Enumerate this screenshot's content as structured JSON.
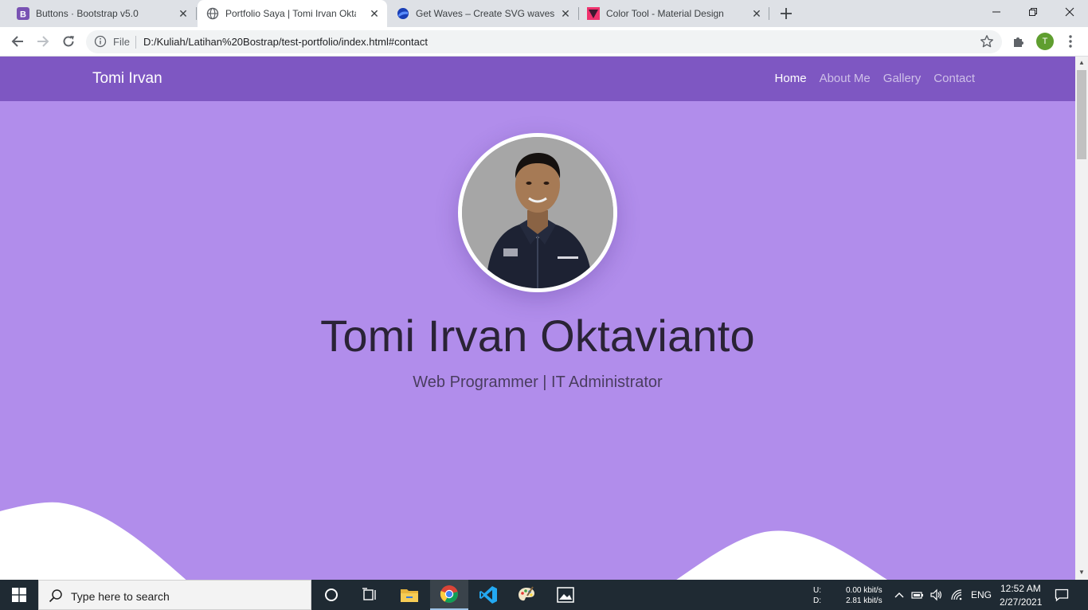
{
  "browser": {
    "tabs": [
      {
        "title": "Buttons · Bootstrap v5.0",
        "icon": "bootstrap-icon",
        "active": false
      },
      {
        "title": "Portfolio Saya | Tomi Irvan Oktavianto",
        "icon": "globe-icon",
        "active": true
      },
      {
        "title": "Get Waves – Create SVG waves for your next design",
        "icon": "getwaves-icon",
        "active": false
      },
      {
        "title": "Color Tool - Material Design",
        "icon": "material-icon",
        "active": false
      }
    ],
    "omnibox": {
      "scheme_label": "File",
      "url": "D:/Kuliah/Latihan%20Bostrap/test-portfolio/index.html#contact"
    },
    "profile_initial": "T"
  },
  "site": {
    "brand": "Tomi Irvan",
    "nav": [
      {
        "label": "Home",
        "active": true
      },
      {
        "label": "About Me",
        "active": false
      },
      {
        "label": "Gallery",
        "active": false
      },
      {
        "label": "Contact",
        "active": false
      }
    ],
    "hero": {
      "name": "Tomi Irvan Oktavianto",
      "role": "Web Programmer | IT Administrator"
    },
    "colors": {
      "navbar": "#7e57c2",
      "hero": "#b18deb",
      "wave": "#ffffff"
    }
  },
  "taskbar": {
    "search_placeholder": "Type here to search",
    "net_upload_label": "U:",
    "net_download_label": "D:",
    "net_upload": "0.00 kbit/s",
    "net_download": "2.81 kbit/s",
    "language": "ENG",
    "time": "12:52 AM",
    "date": "2/27/2021"
  }
}
